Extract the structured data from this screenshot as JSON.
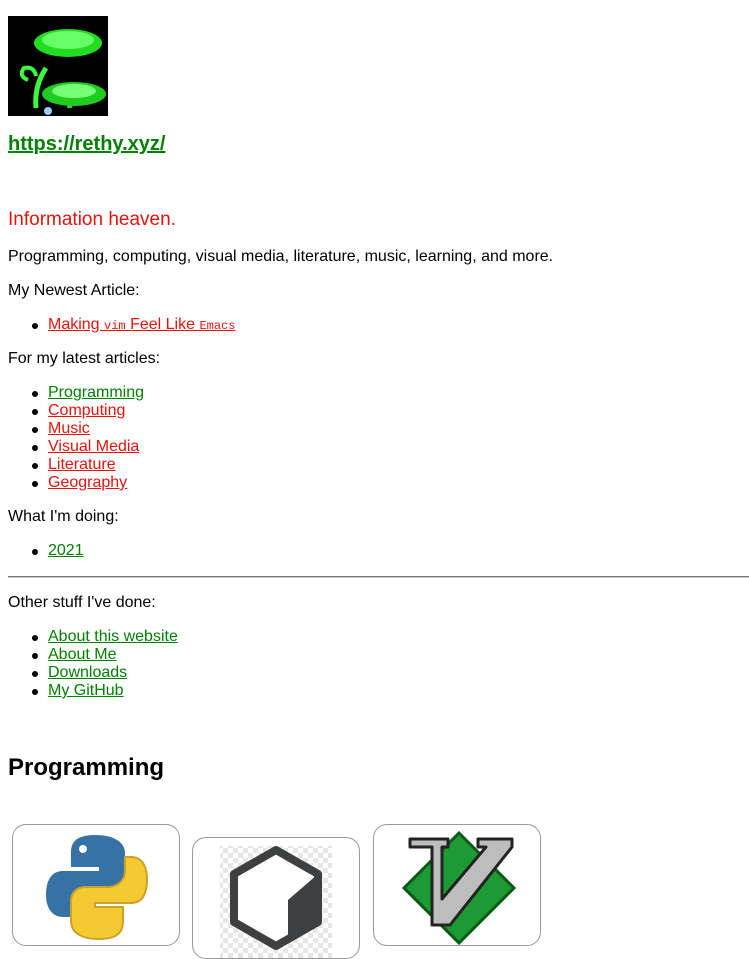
{
  "header": {
    "site_url": "https://rethy.xyz/"
  },
  "tagline": "Information heaven.",
  "intro": "Programming, computing, visual media, literature, music, learning, and more.",
  "newest": {
    "label": "My Newest Article:",
    "article": {
      "prefix": "Making ",
      "code1": "vim",
      "middle": " Feel Like ",
      "code2": "Emacs"
    }
  },
  "latest": {
    "label": "For my latest articles:",
    "items": [
      "Programming",
      "Computing",
      "Music",
      "Visual Media",
      "Literature",
      "Geography"
    ]
  },
  "doing": {
    "label": "What I'm doing:",
    "items": [
      "2021"
    ]
  },
  "other": {
    "label": "Other stuff I've done:",
    "items": [
      "About this website",
      "About Me",
      "Downloads",
      "My GitHub"
    ]
  },
  "section": {
    "title": "Programming"
  },
  "colors": {
    "link_green": "#008000",
    "link_red": "#e8120c"
  },
  "cards": [
    {
      "icon": "python-logo-icon"
    },
    {
      "icon": "hexagon-logo-icon"
    },
    {
      "icon": "vim-logo-icon"
    }
  ]
}
